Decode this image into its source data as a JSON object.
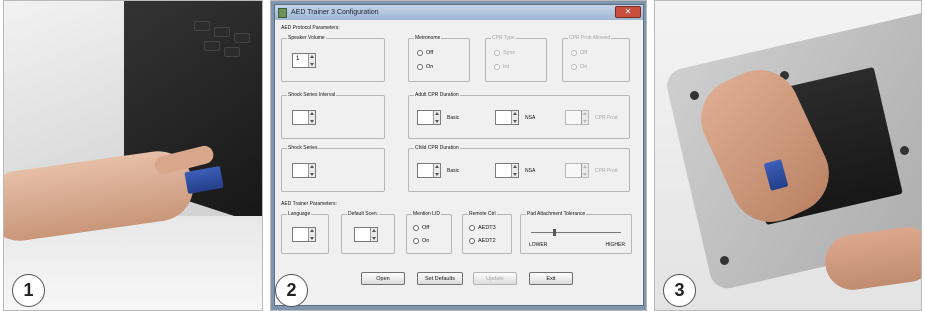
{
  "steps": {
    "one": "1",
    "two": "2",
    "three": "3"
  },
  "window": {
    "title": "AED Trainer 3 Configuration",
    "close_glyph": "✕"
  },
  "protocol": {
    "section_label": "AED Protocol Parameters:",
    "speaker_volume": {
      "label": "Speaker Volume",
      "value": "1"
    },
    "metronome": {
      "label": "Metronome",
      "off": "Off",
      "on": "On"
    },
    "cpr_type": {
      "label": "CPR Type",
      "opt1": "Sync",
      "opt2": "Int"
    },
    "cpr_prob_allowed": {
      "label": "CPR Prob Allowed",
      "off": "Off",
      "on": "On"
    },
    "shock_series_interval": {
      "label": "Shock Series Interval"
    },
    "adult_cpr_duration": {
      "label": "Adult CPR Duration",
      "basic": "Basic",
      "nsa": "NSA",
      "cpr_prod": "CPR Prod"
    },
    "shock_series": {
      "label": "Shock Series"
    },
    "child_cpr_duration": {
      "label": "Child CPR Duration",
      "basic": "Basic",
      "nsa": "NSA",
      "cpr_prod": "CPR Prod"
    }
  },
  "trainer": {
    "section_label": "AED Trainer Parameters:",
    "language": {
      "label": "Language"
    },
    "default_scen": {
      "label": "Default Scen."
    },
    "mention_lid": {
      "label": "Mention LID",
      "off": "Off",
      "on": "On"
    },
    "remote_ctrl": {
      "label": "Remote Ctrl",
      "opt1": "AEDT3",
      "opt2": "AEDT2"
    },
    "pad_tolerance": {
      "label": "Pad Attachment Tolerance",
      "lower": "LOWER",
      "higher": "HIGHER",
      "level": 0.25
    }
  },
  "buttons": {
    "open": "Open",
    "set_defaults": "Set Defaults",
    "update": "Update",
    "exit": "Exit"
  },
  "colors": {
    "card_blue": "#2f4f9f",
    "window_bg": "#f0f0f0",
    "desktop_bg": "#7e95ad"
  }
}
